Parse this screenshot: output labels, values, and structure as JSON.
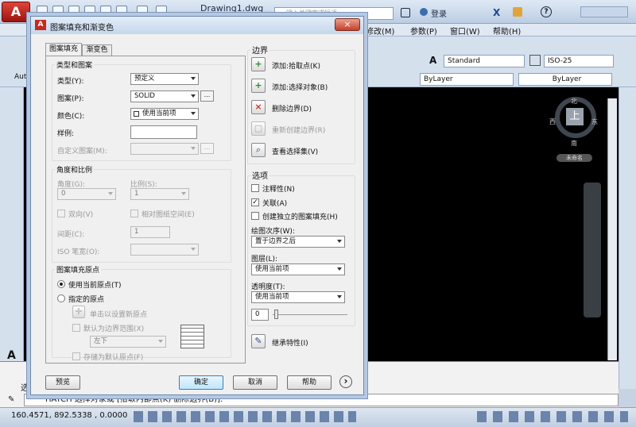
{
  "app": {
    "doc_title": "Drawing1.dwg",
    "search_placeholder": "键入关键字或短语",
    "login": "登录",
    "menus": [
      "修改(M)",
      "参数(P)",
      "窗口(W)",
      "帮助(H)"
    ],
    "logo_letter": "A"
  },
  "toolbar": {
    "text_style": "Standard",
    "dim_style": "ISO-25",
    "layer_left": "Auto",
    "color_combo": "ByLayer",
    "linetype_combo": "ByLayer"
  },
  "viewcube": {
    "north": "北",
    "south": "南",
    "east": "东",
    "west": "西",
    "top": "上",
    "wcs": "未命名"
  },
  "command": {
    "prefix": "选",
    "text": "HATCH 选择对象或 [拾取内部点(K) 删除边界(B)]:"
  },
  "status": {
    "coords": "160.4571, 892.5338 , 0.0000"
  },
  "dialog": {
    "title": "图案填充和渐变色",
    "close": "×",
    "tabs": [
      "图案填充",
      "渐变色"
    ],
    "type_pattern": {
      "title": "类型和图案",
      "type_label": "类型(Y):",
      "type_value": "预定义",
      "pattern_label": "图案(P):",
      "pattern_value": "SOLID",
      "color_label": "颜色(C):",
      "color_value": "使用当前项",
      "sample_label": "样例:",
      "custom_label": "自定义图案(M):",
      "dots": "..."
    },
    "angle_scale": {
      "title": "角度和比例",
      "angle_label": "角度(G):",
      "angle_value": "0",
      "scale_label": "比例(S):",
      "scale_value": "1",
      "double_label": "双向(V)",
      "relative_label": "相对图纸空间(E)",
      "spacing_label": "间距(C):",
      "spacing_value": "1",
      "iso_label": "ISO 笔宽(O):"
    },
    "origin": {
      "title": "图案填充原点",
      "use_current": "使用当前原点(T)",
      "specified": "指定的原点",
      "click_set": "单击以设置新原点",
      "default_extents": "默认为边界范围(X)",
      "position": "左下",
      "store_default": "存储为默认原点(F)"
    },
    "boundary": {
      "title": "边界",
      "add_pick": "添加:拾取点(K)",
      "add_select": "添加:选择对象(B)",
      "remove": "删除边界(D)",
      "recreate": "重新创建边界(R)",
      "view_selection": "查看选择集(V)"
    },
    "options": {
      "title": "选项",
      "annotative": "注释性(N)",
      "associative": "关联(A)",
      "separate": "创建独立的图案填充(H)",
      "draw_order_label": "绘图次序(W):",
      "draw_order_value": "置于边界之后",
      "layer_label": "图层(L):",
      "layer_value": "使用当前项",
      "transparency_label": "透明度(T):",
      "transparency_value": "使用当前项",
      "transparency_number": "0"
    },
    "inherit": "继承特性(I)",
    "buttons": {
      "preview": "预览",
      "ok": "确定",
      "cancel": "取消",
      "help": "帮助",
      "more": "›"
    }
  }
}
